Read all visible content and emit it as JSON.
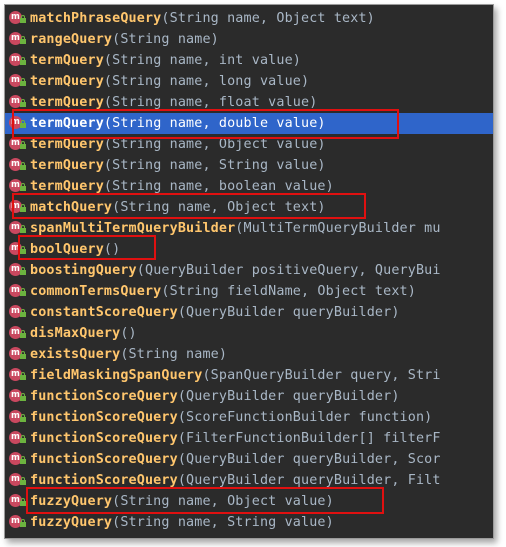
{
  "rows": [
    {
      "icon": "m",
      "name": "matchPhraseQuery",
      "params": "(String name, Object text)"
    },
    {
      "icon": "m",
      "name": "rangeQuery",
      "params": "(String name)"
    },
    {
      "icon": "m",
      "name": "termQuery",
      "params": "(String name, int value)"
    },
    {
      "icon": "m",
      "name": "termQuery",
      "params": "(String name, long value)"
    },
    {
      "icon": "m",
      "name": "termQuery",
      "params": "(String name, float value)"
    },
    {
      "icon": "m",
      "name": "termQuery",
      "params": "(String name, double value)"
    },
    {
      "icon": "m",
      "name": "termQuery",
      "params": "(String name, Object value)"
    },
    {
      "icon": "m",
      "name": "termQuery",
      "params": "(String name, String value)"
    },
    {
      "icon": "m",
      "name": "termQuery",
      "params": "(String name, boolean value)"
    },
    {
      "icon": "m",
      "name": "matchQuery",
      "params": "(String name, Object text)"
    },
    {
      "icon": "m",
      "name": "spanMultiTermQueryBuilder",
      "params": "(MultiTermQueryBuilder mu"
    },
    {
      "icon": "m",
      "name": "boolQuery",
      "params": "()"
    },
    {
      "icon": "m",
      "name": "boostingQuery",
      "params": "(QueryBuilder positiveQuery, QueryBui"
    },
    {
      "icon": "m",
      "name": "commonTermsQuery",
      "params": "(String fieldName, Object text)"
    },
    {
      "icon": "m",
      "name": "constantScoreQuery",
      "params": "(QueryBuilder queryBuilder)"
    },
    {
      "icon": "m",
      "name": "disMaxQuery",
      "params": "()"
    },
    {
      "icon": "m",
      "name": "existsQuery",
      "params": "(String name)"
    },
    {
      "icon": "m",
      "name": "fieldMaskingSpanQuery",
      "params": "(SpanQueryBuilder query, Stri"
    },
    {
      "icon": "m",
      "name": "functionScoreQuery",
      "params": "(QueryBuilder queryBuilder)"
    },
    {
      "icon": "m",
      "name": "functionScoreQuery",
      "params": "(ScoreFunctionBuilder function)"
    },
    {
      "icon": "m",
      "name": "functionScoreQuery",
      "params": "(FilterFunctionBuilder[] filterF"
    },
    {
      "icon": "m",
      "name": "functionScoreQuery",
      "params": "(QueryBuilder queryBuilder, Scor"
    },
    {
      "icon": "m",
      "name": "functionScoreQuery",
      "params": "(QueryBuilder queryBuilder, Filt"
    },
    {
      "icon": "m",
      "name": "fuzzyQuery",
      "params": "(String name, Object value)"
    },
    {
      "icon": "m",
      "name": "fuzzyQuery",
      "params": "(String name, String value)"
    }
  ],
  "selected_index": 5,
  "colors": {
    "popup_background": "#2b2b2b",
    "method_name": "#ffc66d",
    "params": "#a9b7c6",
    "selection": "#2f65ca",
    "method_icon": "#c9485f",
    "public_icon": "#6cb33f",
    "highlight_box": "#e01010"
  },
  "icons": {
    "method": "method-m-icon",
    "visibility": "public-lock-icon"
  }
}
